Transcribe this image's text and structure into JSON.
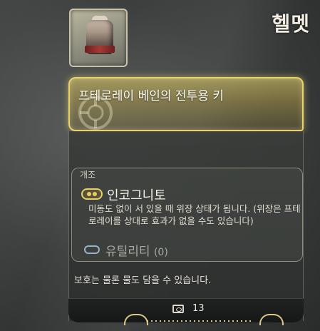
{
  "item": {
    "category_title": "헬멧",
    "name": "프테로레이 베인의 전투용 키",
    "thumbnail_icon": "helmet-icon"
  },
  "modification": {
    "section_label": "개조",
    "slot_name": "인코그니토",
    "slot_icon": "incognito-mod-icon",
    "description": "미동도 없이 서 있을 때 위장 상태가 됩니다. (위장은 프테로레이를 상대로 효과가 없을 수도 있습니다)",
    "utility_label": "유틸리티",
    "utility_count": "(0)",
    "utility_icon": "utility-slot-icon"
  },
  "flavor_text": "보호는 물론 물도 담을 수 있습니다.",
  "cost": {
    "icon": "currency-icon",
    "value": "13"
  },
  "colors": {
    "highlight_gold": "#e8d26a",
    "utility_blue": "#9ab0c8"
  }
}
